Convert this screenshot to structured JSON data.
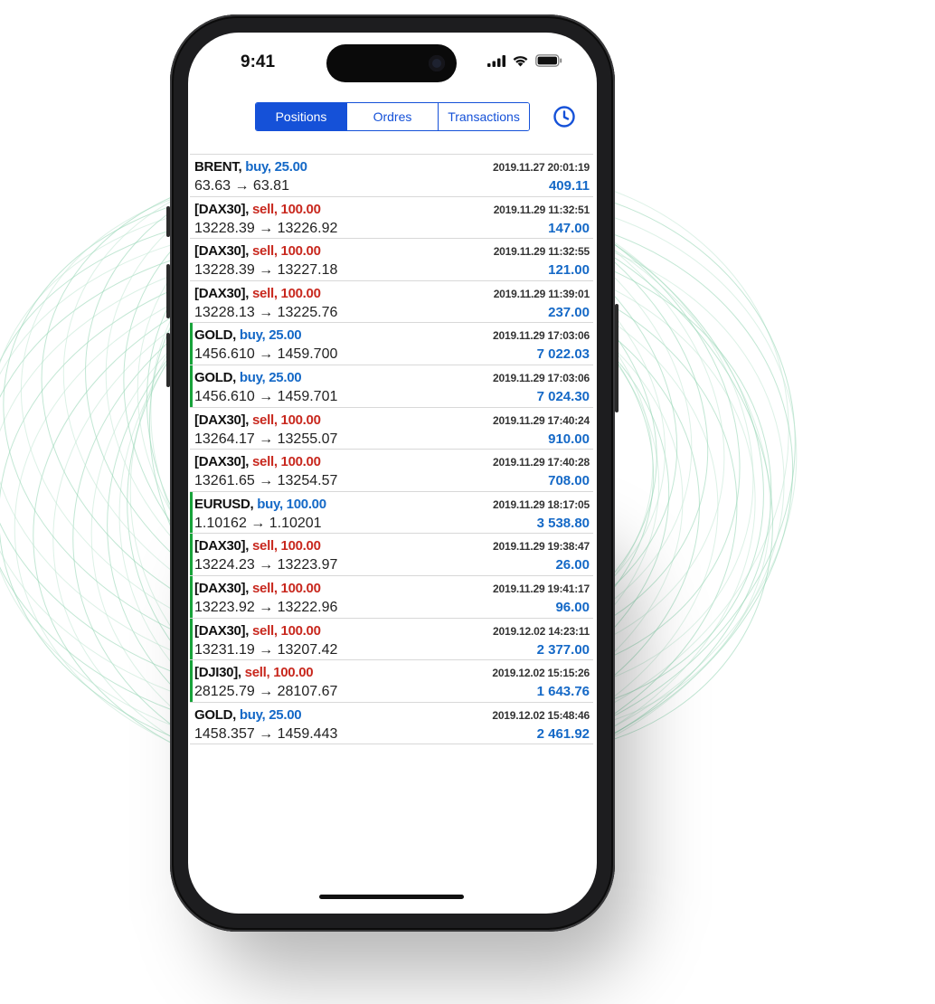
{
  "status_bar": {
    "time": "9:41",
    "icons": [
      "signal-icon",
      "wifi-icon",
      "battery-icon"
    ]
  },
  "tabs": [
    {
      "label": "Positions",
      "active": true
    },
    {
      "label": "Ordres",
      "active": false
    },
    {
      "label": "Transactions",
      "active": false
    }
  ],
  "history_icon": "clock-icon",
  "colors": {
    "accent": "#1551d8",
    "buy": "#1569c7",
    "sell": "#c8281e",
    "profit": "#1569c7",
    "highlight_bar": "#18a33a"
  },
  "deals": [
    {
      "symbol": "BRENT,",
      "side": "buy, 25.00",
      "type": "buy",
      "time": "2019.11.27 20:01:19",
      "prices": "63.63 → 63.81",
      "profit": "409.11",
      "highlight": false
    },
    {
      "symbol": "[DAX30],",
      "side": "sell, 100.00",
      "type": "sell",
      "time": "2019.11.29 11:32:51",
      "prices": "13228.39 → 13226.92",
      "profit": "147.00",
      "highlight": false
    },
    {
      "symbol": "[DAX30],",
      "side": "sell, 100.00",
      "type": "sell",
      "time": "2019.11.29 11:32:55",
      "prices": "13228.39 → 13227.18",
      "profit": "121.00",
      "highlight": false
    },
    {
      "symbol": "[DAX30],",
      "side": "sell, 100.00",
      "type": "sell",
      "time": "2019.11.29 11:39:01",
      "prices": "13228.13 → 13225.76",
      "profit": "237.00",
      "highlight": false
    },
    {
      "symbol": "GOLD,",
      "side": "buy, 25.00",
      "type": "buy",
      "time": "2019.11.29 17:03:06",
      "prices": "1456.610 → 1459.700",
      "profit": "7 022.03",
      "highlight": true
    },
    {
      "symbol": "GOLD,",
      "side": "buy, 25.00",
      "type": "buy",
      "time": "2019.11.29 17:03:06",
      "prices": "1456.610 → 1459.701",
      "profit": "7 024.30",
      "highlight": true
    },
    {
      "symbol": "[DAX30],",
      "side": "sell, 100.00",
      "type": "sell",
      "time": "2019.11.29 17:40:24",
      "prices": "13264.17 → 13255.07",
      "profit": "910.00",
      "highlight": false
    },
    {
      "symbol": "[DAX30],",
      "side": "sell, 100.00",
      "type": "sell",
      "time": "2019.11.29 17:40:28",
      "prices": "13261.65 → 13254.57",
      "profit": "708.00",
      "highlight": false
    },
    {
      "symbol": "EURUSD,",
      "side": "buy, 100.00",
      "type": "buy",
      "time": "2019.11.29 18:17:05",
      "prices": "1.10162 → 1.10201",
      "profit": "3 538.80",
      "highlight": true
    },
    {
      "symbol": "[DAX30],",
      "side": "sell, 100.00",
      "type": "sell",
      "time": "2019.11.29 19:38:47",
      "prices": "13224.23 → 13223.97",
      "profit": "26.00",
      "highlight": true
    },
    {
      "symbol": "[DAX30],",
      "side": "sell, 100.00",
      "type": "sell",
      "time": "2019.11.29 19:41:17",
      "prices": "13223.92 → 13222.96",
      "profit": "96.00",
      "highlight": true
    },
    {
      "symbol": "[DAX30],",
      "side": "sell, 100.00",
      "type": "sell",
      "time": "2019.12.02 14:23:11",
      "prices": "13231.19 → 13207.42",
      "profit": "2 377.00",
      "highlight": true
    },
    {
      "symbol": "[DJI30],",
      "side": "sell, 100.00",
      "type": "sell",
      "time": "2019.12.02 15:15:26",
      "prices": "28125.79 → 28107.67",
      "profit": "1 643.76",
      "highlight": true
    },
    {
      "symbol": "GOLD,",
      "side": "buy, 25.00",
      "type": "buy",
      "time": "2019.12.02 15:48:46",
      "prices": "1458.357 → 1459.443",
      "profit": "2 461.92",
      "highlight": false
    }
  ]
}
